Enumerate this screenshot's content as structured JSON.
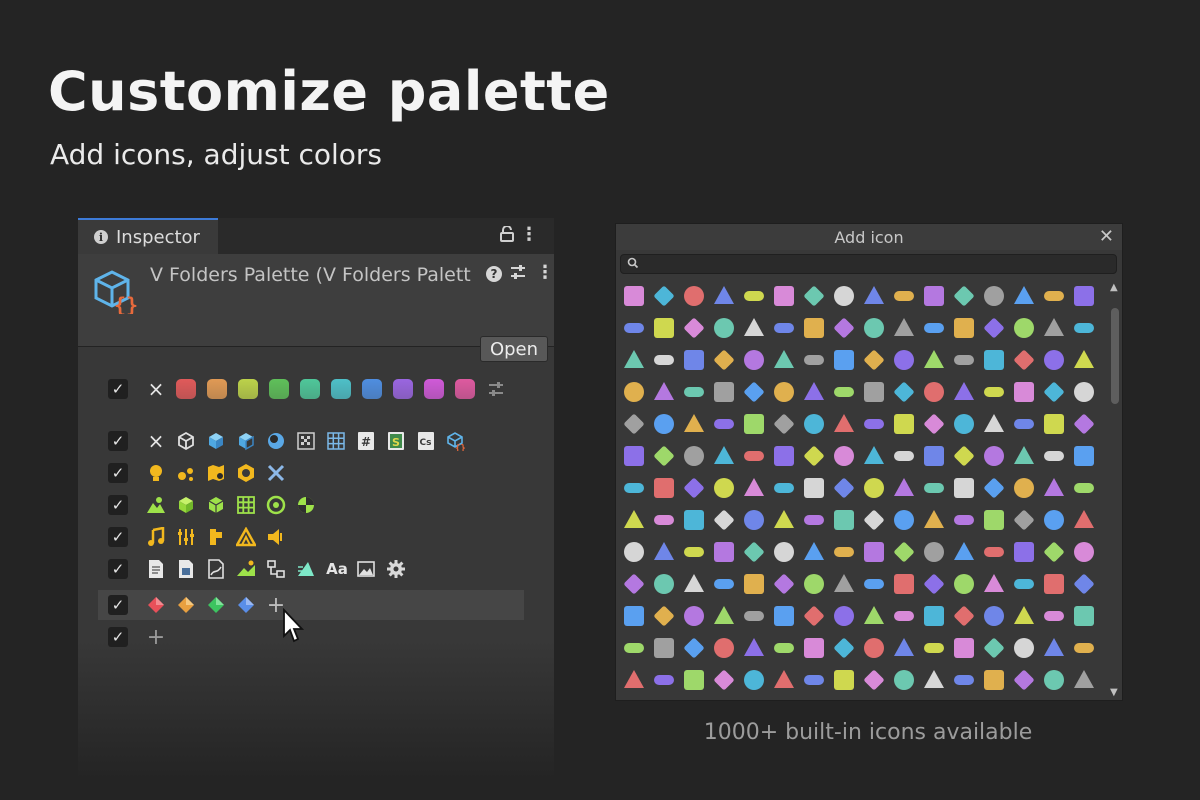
{
  "headline": {
    "title": "Customize palette",
    "subtitle": "Add icons, adjust colors"
  },
  "inspector": {
    "tab_label": "Inspector",
    "asset_name": "V Folders Palette (V Folders Palett",
    "open_label": "Open",
    "icons": {
      "tab": "info-icon",
      "lock": "lock-icon",
      "menu": "kebab-menu-icon",
      "help": "help-icon",
      "settings": "sliders-icon",
      "asset": "script-asset-icon"
    },
    "color_row": {
      "colors": [
        "#e05a5a",
        "#e09a55",
        "#bcd24a",
        "#5fc05a",
        "#4fc79a",
        "#4ec0c8",
        "#4f8ee0",
        "#9a66e0",
        "#d05ad8",
        "#de5aa0"
      ]
    },
    "rows": [
      {
        "icons": [
          "close-icon",
          "prefab-icon",
          "cube-icon",
          "prefab-variant-icon",
          "sphere-icon",
          "checker-icon",
          "grid-icon",
          "hash-script-icon",
          "shader-icon",
          "csharp-icon",
          "script-icon"
        ]
      },
      {
        "icons": [
          "lightbulb-icon",
          "particles-icon",
          "map-icon",
          "hexagon-icon",
          "satellite-icon"
        ]
      },
      {
        "icons": [
          "terrain-icon",
          "green-cube-icon",
          "green-box-icon",
          "grid-icon",
          "wheel-icon",
          "half-circle-icon"
        ]
      },
      {
        "icons": [
          "music-note-icon",
          "mixer-icon",
          "film-icon",
          "audio-source-icon",
          "speaker-icon"
        ]
      },
      {
        "icons": [
          "document-icon",
          "file-icon",
          "chart-icon",
          "landscape-icon",
          "hierarchy-icon",
          "triangle-icon",
          "font-icon",
          "image-icon",
          "gear-icon"
        ]
      },
      {
        "icons": [
          "red-diamond-icon",
          "orange-diamond-icon",
          "green-diamond-icon",
          "blue-diamond-icon",
          "plus-icon"
        ]
      },
      {
        "icons": [
          "plus-icon"
        ]
      }
    ],
    "font_label": "Aa"
  },
  "add_icon": {
    "title": "Add icon",
    "icons": {
      "close": "close-icon",
      "search": "search-icon",
      "scroll_up": "arrow-up-icon",
      "scroll_down": "arrow-down-icon"
    },
    "caption": "1000+ built-in icons available",
    "palette": [
      "#d88ad8",
      "#b478e0",
      "#8c70e8",
      "#6f86e8",
      "#5aa0f0",
      "#4db6d8",
      "#6cc8b0",
      "#9ed86a",
      "#cfd84f",
      "#e0b04e",
      "#e06e6e",
      "#d6d6d6",
      "#a0a0a0"
    ]
  }
}
